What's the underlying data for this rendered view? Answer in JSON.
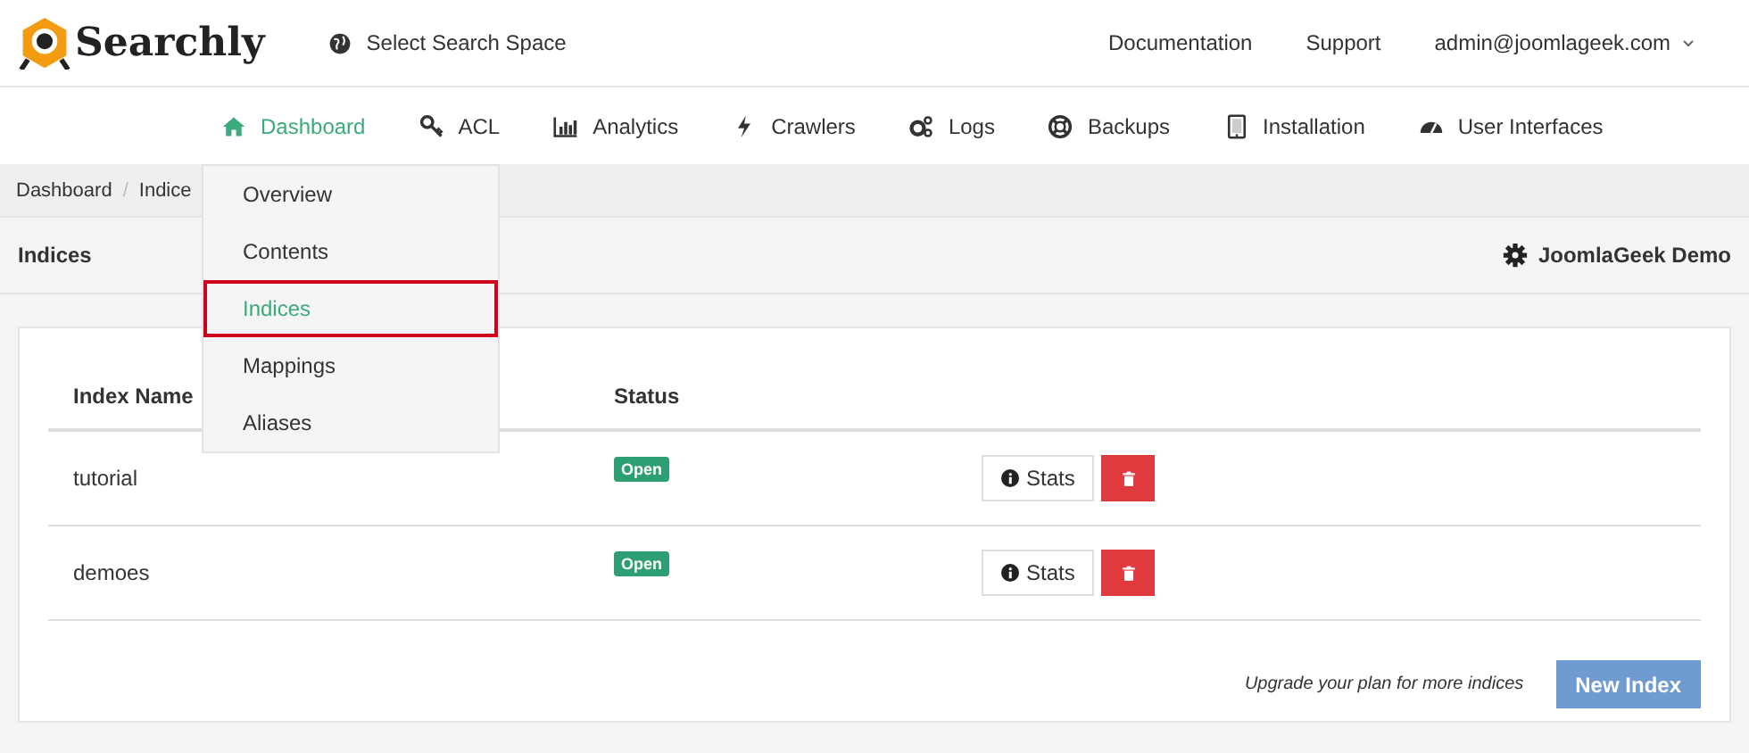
{
  "header": {
    "brand": "Searchly",
    "space_selector": "Select Search Space",
    "links": [
      "Documentation",
      "Support"
    ],
    "user_menu": "admin@joomlageek.com"
  },
  "nav": [
    {
      "label": "Dashboard",
      "selected": true
    },
    {
      "label": "ACL",
      "selected": false
    },
    {
      "label": "Analytics",
      "selected": false
    },
    {
      "label": "Crawlers",
      "selected": false
    },
    {
      "label": "Logs",
      "selected": false
    },
    {
      "label": "Backups",
      "selected": false
    },
    {
      "label": "Installation",
      "selected": false
    },
    {
      "label": "User Interfaces",
      "selected": false
    }
  ],
  "dropdown": [
    {
      "label": "Overview",
      "selected": false
    },
    {
      "label": "Contents",
      "selected": false
    },
    {
      "label": "Indices",
      "selected": true
    },
    {
      "label": "Mappings",
      "selected": false
    },
    {
      "label": "Aliases",
      "selected": false
    }
  ],
  "breadcrumb": {
    "items": [
      "Dashboard",
      "Indice"
    ],
    "separator": "/"
  },
  "page_title": "Indices",
  "space_name": "JoomlaGeek Demo",
  "table": {
    "columns": [
      "Index Name",
      "Status"
    ],
    "rows": [
      {
        "name": "tutorial",
        "status": "Open",
        "stats_button": "Stats"
      },
      {
        "name": "demoes",
        "status": "Open",
        "stats_button": "Stats"
      }
    ]
  },
  "upgrade_note": "Upgrade your plan for more indices",
  "new_button": "New Index"
}
